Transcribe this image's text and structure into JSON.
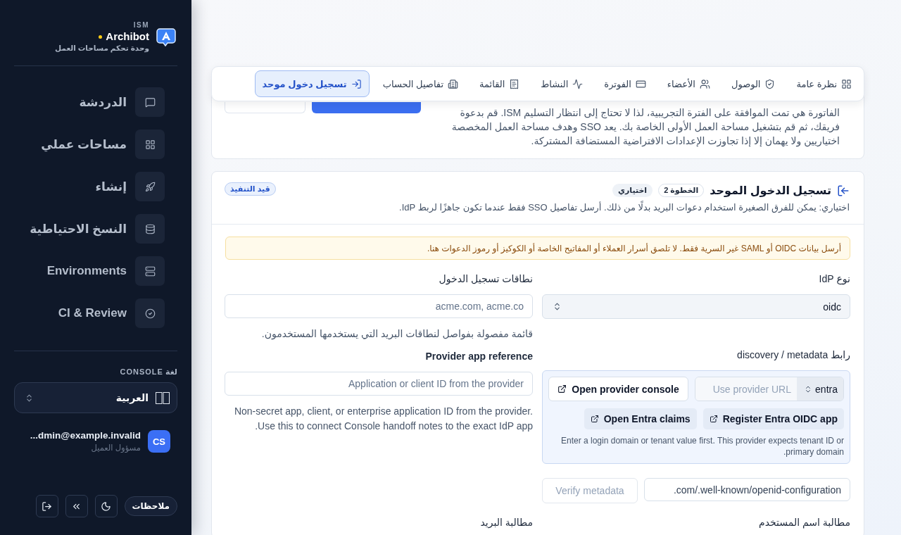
{
  "sidebar": {
    "brand": {
      "eyebrow": "ISM",
      "name": "Archibot",
      "subtitle": "وحدة تحكم مساحات العمل"
    },
    "nav": [
      {
        "label": "الدردشة"
      },
      {
        "label": "مساحات عملي"
      },
      {
        "label": "إنشاء"
      },
      {
        "label": "النسخ الاحتياطية"
      },
      {
        "label": "Environments"
      },
      {
        "label": "CI & Review"
      }
    ],
    "language": {
      "label": "لغة CONSOLE",
      "value": "العربية"
    },
    "user": {
      "initials": "CS",
      "email": "dmin@example.invalid...",
      "role": "مسؤول العميل"
    },
    "notes_button": "ملاحظات"
  },
  "tabs": [
    {
      "label": "نظرة عامة",
      "selected": false
    },
    {
      "label": "الوصول",
      "selected": false
    },
    {
      "label": "الأعضاء",
      "selected": false
    },
    {
      "label": "الفوترة",
      "selected": false
    },
    {
      "label": "النشاط",
      "selected": false
    },
    {
      "label": "القائمة",
      "selected": false
    },
    {
      "label": "تفاصيل الحساب",
      "selected": false
    },
    {
      "label": "تسجيل دخول موحد",
      "selected": true
    }
  ],
  "intro": {
    "text": "الفاتورة هي تمت الموافقة على الفترة التجريبية، لذا لا تحتاج إلى انتظار التسليم ISM. قم بدعوة فريقك، ثم قم بتشغيل مساحة العمل الأولى الخاصة بك. يعد SSO وهدف مساحة العمل المخصصة اختياريين ولا يهمان إلا إذا تجاوزت الإعدادات الافتراضية المستضافة المشتركة."
  },
  "sso": {
    "title": "تسجيل الدخول الموحد",
    "step": "الخطوة 2",
    "optional": "اختياري",
    "status": "قيد التنفيذ",
    "description": "اختياري: يمكن للفرق الصغيرة استخدام دعوات البريد بدلًا من ذلك. أرسل تفاصيل SSO فقط عندما تكون جاهزًا لربط IdP.",
    "warning": "أرسل بيانات OIDC أو SAML غير السرية فقط. لا تلصق أسرار العملاء أو المفاتيح الخاصة أو الكوكيز أو رموز الدعوات هنا.",
    "idp_type": {
      "label": "نوع IdP",
      "value": "oidc"
    },
    "domains": {
      "label": "نطاقات تسجيل الدخول",
      "placeholder": "acme.com, acme.co",
      "hint": "قائمة مفصولة بفواصل لنطاقات البريد التي يستخدمها المستخدمون."
    },
    "discovery": {
      "label": "رابط discovery / metadata",
      "provider": "entra",
      "url_placeholder": "Use provider URL",
      "console_button": "Open provider console",
      "register_button": "Register Entra OIDC app",
      "claims_button": "Open Entra claims",
      "note": "Enter a login domain or tenant value first. This provider expects tenant ID or primary domain.",
      "url_value": ".com/.well-known/openid-configuration",
      "verify_button": {
        "label": "Verify metadata",
        "disabled": true
      }
    },
    "app_ref": {
      "label": "Provider app reference",
      "placeholder": "Application or client ID from the provider",
      "hint": "Non-secret app, client, or enterprise application ID from the provider. Use this to connect Console handoff notes to the exact IdP app."
    },
    "next_labels": [
      "مطالبة اسم المستخدم",
      "مطالبة البريد"
    ]
  }
}
